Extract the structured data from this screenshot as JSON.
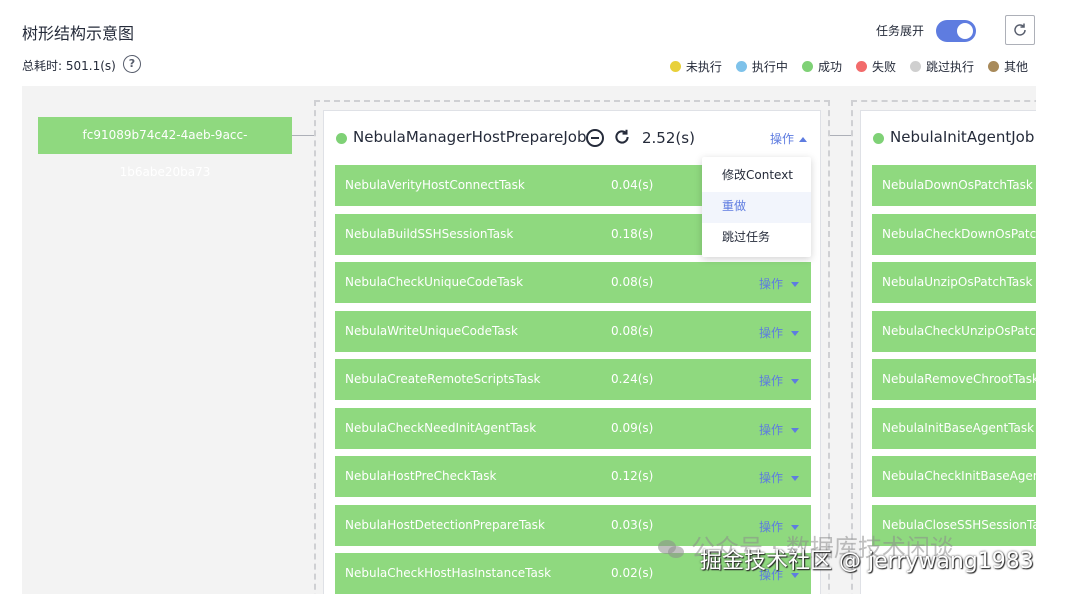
{
  "header": {
    "title": "树形结构示意图",
    "total_time": "总耗时: 501.1(s)",
    "help_symbol": "?",
    "expand_label": "任务展开",
    "expand_toggle_on": true
  },
  "legend": [
    {
      "label": "未执行",
      "color": "#e8d03a"
    },
    {
      "label": "执行中",
      "color": "#7ec2ea"
    },
    {
      "label": "成功",
      "color": "#7fd176"
    },
    {
      "label": "失败",
      "color": "#f26b6b"
    },
    {
      "label": "跳过执行",
      "color": "#cfcfcf"
    },
    {
      "label": "其他",
      "color": "#a88a5a"
    }
  ],
  "root": {
    "id": "fc91089b74c42-4aeb-9acc-1b6abe20ba73"
  },
  "jobs": [
    {
      "name": "NebulaManagerHostPrepareJob",
      "time": "2.52(s)",
      "op_label": "操作",
      "tasks": [
        {
          "name": "NebulaVerityHostConnectTask",
          "time": "0.04(s)",
          "op": ""
        },
        {
          "name": "NebulaBuildSSHSessionTask",
          "time": "0.18(s)",
          "op": ""
        },
        {
          "name": "NebulaCheckUniqueCodeTask",
          "time": "0.08(s)",
          "op": "操作"
        },
        {
          "name": "NebulaWriteUniqueCodeTask",
          "time": "0.08(s)",
          "op": "操作"
        },
        {
          "name": "NebulaCreateRemoteScriptsTask",
          "time": "0.24(s)",
          "op": "操作"
        },
        {
          "name": "NebulaCheckNeedInitAgentTask",
          "time": "0.09(s)",
          "op": "操作"
        },
        {
          "name": "NebulaHostPreCheckTask",
          "time": "0.12(s)",
          "op": "操作"
        },
        {
          "name": "NebulaHostDetectionPrepareTask",
          "time": "0.03(s)",
          "op": "操作"
        },
        {
          "name": "NebulaCheckHostHasInstanceTask",
          "time": "0.02(s)",
          "op": "操作"
        }
      ]
    },
    {
      "name": "NebulaInitAgentJob",
      "tasks": [
        {
          "name": "NebulaDownOsPatchTask"
        },
        {
          "name": "NebulaCheckDownOsPatchTask"
        },
        {
          "name": "NebulaUnzipOsPatchTask"
        },
        {
          "name": "NebulaCheckUnzipOsPatchTask"
        },
        {
          "name": "NebulaRemoveChrootTask"
        },
        {
          "name": "NebulaInitBaseAgentTask"
        },
        {
          "name": "NebulaCheckInitBaseAgentTask"
        },
        {
          "name": "NebulaCloseSSHSessionTask"
        }
      ]
    }
  ],
  "dropdown": {
    "items": [
      "修改Context",
      "重做",
      "跳过任务"
    ],
    "active_index": 1
  },
  "watermark": {
    "line1": "公众号 · 数据库技术闲谈",
    "line2": "掘金技术社区 @ jerrywang1983"
  }
}
